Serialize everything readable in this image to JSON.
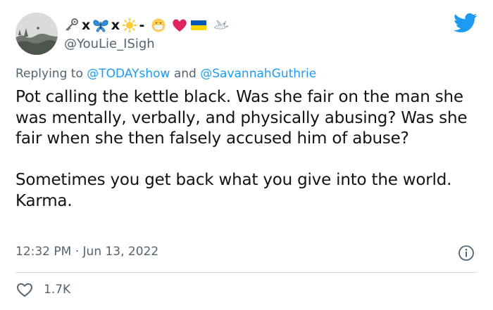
{
  "author": {
    "display_name_emojis": [
      "key-icon",
      "x",
      "butterfly-icon",
      "x",
      "sun-icon",
      "-",
      "mask-face-icon",
      "heart-icon",
      "ukraine-flag-icon",
      "dove-icon"
    ],
    "display_name_text_x1": "x",
    "display_name_text_x2": "x",
    "display_name_text_dash": "-",
    "handle": "@YouLie_ISigh"
  },
  "reply": {
    "prefix": "Replying to ",
    "mention_1": "@TODAYshow",
    "conjunction": " and ",
    "mention_2": "@SavannahGuthrie"
  },
  "tweet": {
    "paragraph_1": "Pot calling the kettle black. Was she fair on the man she was mentally, verbally, and physically abusing? Was she fair when she then falsely accused him of abuse?",
    "paragraph_2": "Sometimes you get back what you give into the world. Karma.",
    "timestamp": "12:32 PM · Jun 13, 2022"
  },
  "stats": {
    "likes": "1.7K"
  },
  "colors": {
    "twitter_blue": "#1d9bf0",
    "secondary_text": "#536471",
    "heart_red": "#e0245e",
    "flag_blue": "#0057b7",
    "flag_yellow": "#ffd700"
  }
}
